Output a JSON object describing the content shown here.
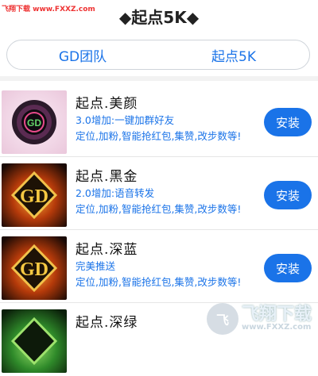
{
  "watermark_top": "飞翔下载 www.FXXZ.com",
  "header": {
    "title": "◆起点5K◆"
  },
  "tabs": [
    {
      "label": "GD团队"
    },
    {
      "label": "起点5K"
    }
  ],
  "apps": [
    {
      "name": "起点.美颜",
      "line1": "3.0增加:一键加群好友",
      "line2": "定位,加粉,智能抢红包,集赞,改步数等!",
      "button": "安装",
      "thumb_icon": "pink-lens-gd-logo"
    },
    {
      "name": "起点.黑金",
      "line1": "2.0增加:语音转发",
      "line2": "定位,加粉,智能抢红包,集赞,改步数等!",
      "button": "安装",
      "thumb_icon": "fire-gd-logo"
    },
    {
      "name": "起点.深蓝",
      "line1": "完美推送",
      "line2": "定位,加粉,智能抢红包,集赞,改步数等!",
      "button": "安装",
      "thumb_icon": "fire-gd-logo"
    },
    {
      "name": "起点.深绿",
      "line1": "",
      "line2": "",
      "button": "",
      "thumb_icon": "green-gd-logo"
    }
  ],
  "watermark_bottom": {
    "brand": "飞翔下载",
    "url": "www.FXXZ.com"
  },
  "colors": {
    "accent": "#1a73e8",
    "border": "#e6e6e6"
  }
}
